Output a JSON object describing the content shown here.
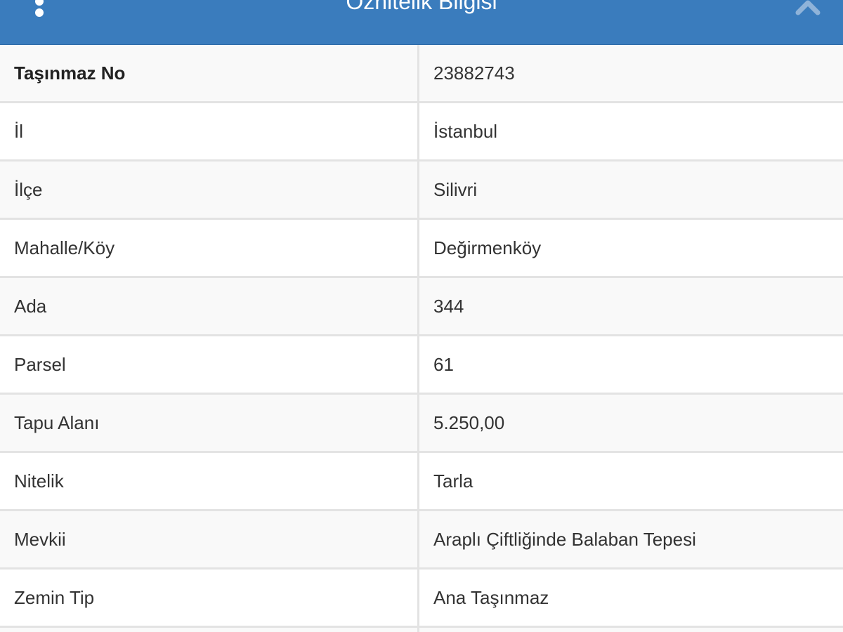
{
  "header": {
    "title": "Öznitelik Bilgisi",
    "menu_icon": "vertical-dots-icon",
    "collapse_icon": "chevron-up-icon",
    "background_color": "#3a7cbd"
  },
  "table": {
    "rows": [
      {
        "key": "Taşınmaz No",
        "value": "23882743"
      },
      {
        "key": "İl",
        "value": "İstanbul"
      },
      {
        "key": "İlçe",
        "value": "Silivri"
      },
      {
        "key": "Mahalle/Köy",
        "value": "Değirmenköy"
      },
      {
        "key": "Ada",
        "value": "344"
      },
      {
        "key": "Parsel",
        "value": "61"
      },
      {
        "key": "Tapu Alanı",
        "value": "5.250,00"
      },
      {
        "key": "Nitelik",
        "value": "Tarla"
      },
      {
        "key": "Mevkii",
        "value": "Araplı Çiftliğinde Balaban Tepesi"
      },
      {
        "key": "Zemin Tip",
        "value": "Ana Taşınmaz"
      }
    ]
  }
}
